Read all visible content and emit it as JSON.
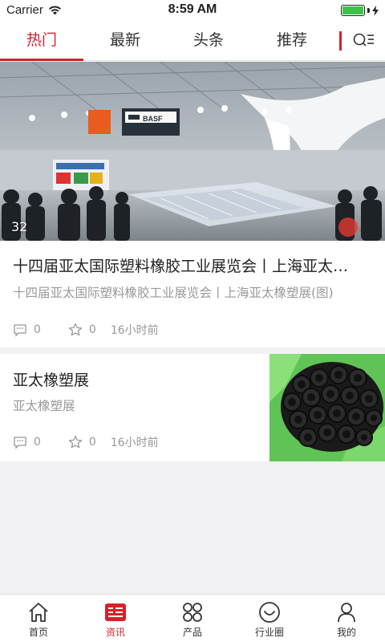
{
  "status_bar": {
    "carrier": "Carrier",
    "time": "8:59 AM"
  },
  "tabs": [
    {
      "label": "热门",
      "active": true
    },
    {
      "label": "最新",
      "active": false
    },
    {
      "label": "头条",
      "active": false
    },
    {
      "label": "推荐",
      "active": false
    }
  ],
  "accent_color": "#d8202a",
  "articles": [
    {
      "image_count": "32",
      "title": "十四届亚太国际塑料橡胶工业展览会丨上海亚太…",
      "subtitle": "十四届亚太国际塑料橡胶工业展览会丨上海亚太橡塑展(图)",
      "comments": "0",
      "favorites": "0",
      "time": "16小时前"
    },
    {
      "title": "亚太橡塑展",
      "subtitle": "亚太橡塑展",
      "comments": "0",
      "favorites": "0",
      "time": "16小时前"
    }
  ],
  "bottom_nav": [
    {
      "label": "首页",
      "icon": "home-icon",
      "active": false
    },
    {
      "label": "资讯",
      "icon": "news-icon",
      "active": true
    },
    {
      "label": "产品",
      "icon": "grid-icon",
      "active": false
    },
    {
      "label": "行业圈",
      "icon": "smile-icon",
      "active": false
    },
    {
      "label": "我的",
      "icon": "user-icon",
      "active": false
    }
  ]
}
